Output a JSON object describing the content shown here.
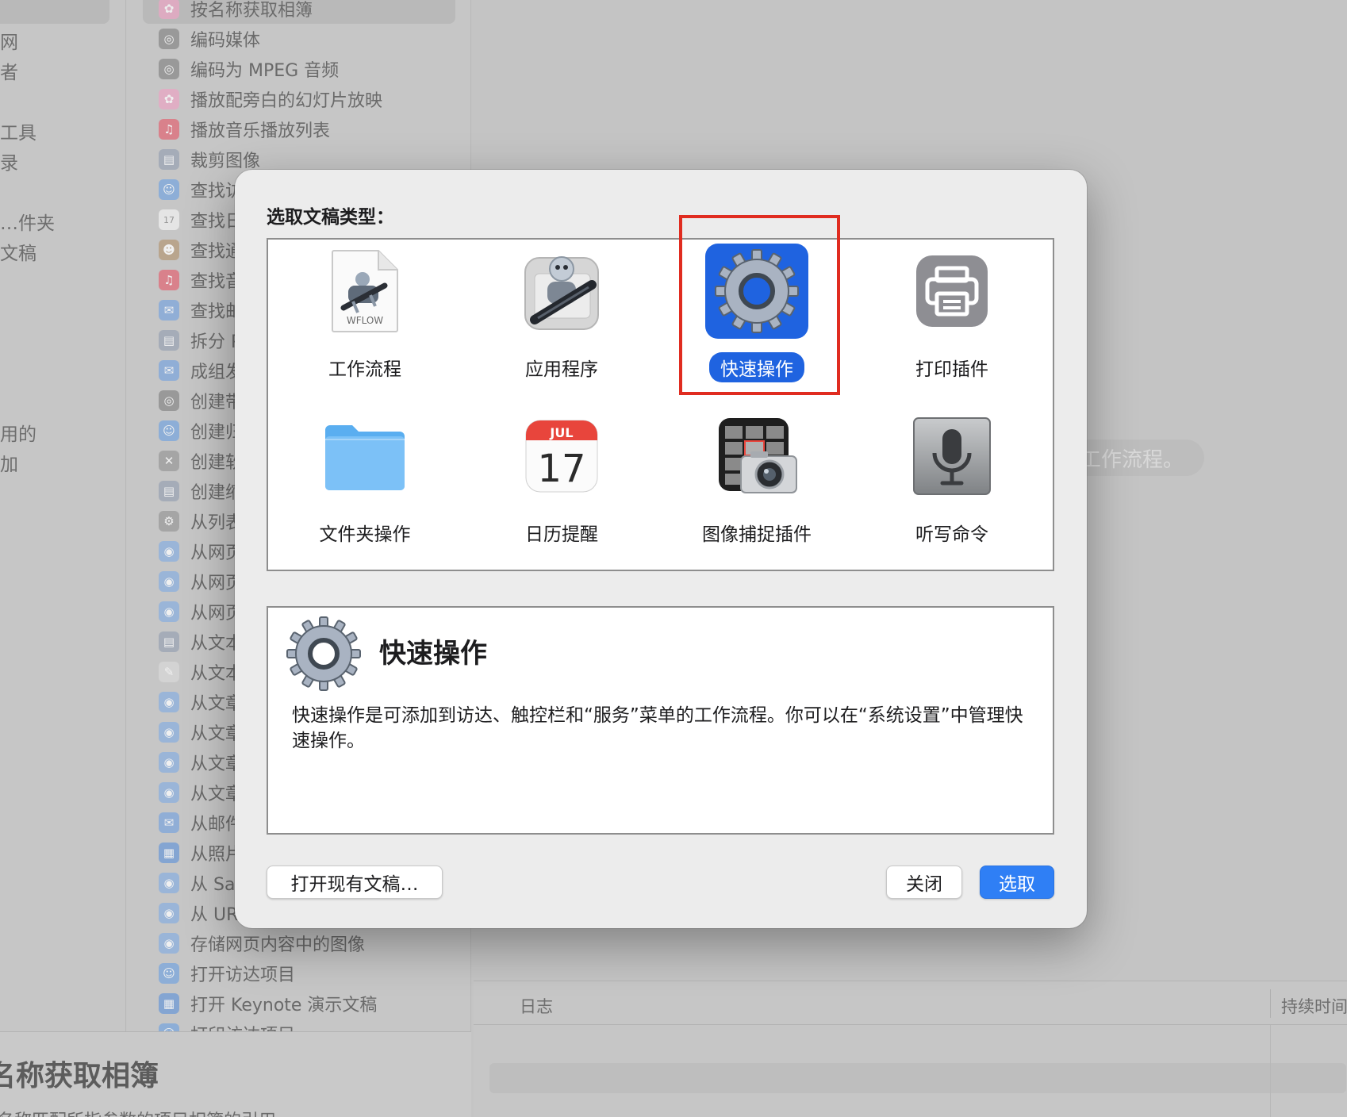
{
  "background": {
    "left_fragments": [
      "网",
      "者",
      "工具",
      "录",
      "…件夹",
      "文稿",
      "用的",
      "加"
    ],
    "action_list": [
      {
        "label": "按名称获取相簿",
        "icon": "photos-icon",
        "color": "#e9a7c4"
      },
      {
        "label": "编码媒体",
        "icon": "quicktime-icon",
        "color": "#8a8a8a"
      },
      {
        "label": "编码为 MPEG 音频",
        "icon": "quicktime-icon",
        "color": "#8a8a8a"
      },
      {
        "label": "播放配旁白的幻灯片放映",
        "icon": "photos-icon",
        "color": "#e9a7c4"
      },
      {
        "label": "播放音乐播放列表",
        "icon": "music-icon",
        "color": "#e06a78"
      },
      {
        "label": "裁剪图像",
        "icon": "preview-icon",
        "color": "#9aa4b4"
      },
      {
        "label": "查找访",
        "icon": "finder-icon",
        "color": "#7aa7dd"
      },
      {
        "label": "查找日",
        "icon": "calendar-icon",
        "color": "#f0f0f0"
      },
      {
        "label": "查找通",
        "icon": "contacts-icon",
        "color": "#b59a7a"
      },
      {
        "label": "查找音",
        "icon": "music-icon",
        "color": "#e06a78"
      },
      {
        "label": "查找邮",
        "icon": "mail-icon",
        "color": "#7fa6dc"
      },
      {
        "label": "拆分 P",
        "icon": "preview-icon",
        "color": "#9aa4b4"
      },
      {
        "label": "成组发",
        "icon": "mail-icon",
        "color": "#7fa6dc"
      },
      {
        "label": "创建带",
        "icon": "quicktime-icon",
        "color": "#8a8a8a"
      },
      {
        "label": "创建归",
        "icon": "finder-icon",
        "color": "#7aa7dd"
      },
      {
        "label": "创建软",
        "icon": "tools-icon",
        "color": "#9a9a9a"
      },
      {
        "label": "创建缩",
        "icon": "preview-icon",
        "color": "#9aa4b4"
      },
      {
        "label": "从列表",
        "icon": "automator-icon",
        "color": "#9a9a9a"
      },
      {
        "label": "从网页",
        "icon": "safari-icon",
        "color": "#8cb0de"
      },
      {
        "label": "从网页",
        "icon": "safari-icon",
        "color": "#8cb0de"
      },
      {
        "label": "从网页",
        "icon": "safari-icon",
        "color": "#8cb0de"
      },
      {
        "label": "从文本",
        "icon": "preview-icon",
        "color": "#9aa4b4"
      },
      {
        "label": "从文本",
        "icon": "textedit-icon",
        "color": "#d8d8d8"
      },
      {
        "label": "从文章",
        "icon": "safari-icon",
        "color": "#8cb0de"
      },
      {
        "label": "从文章",
        "icon": "safari-icon",
        "color": "#8cb0de"
      },
      {
        "label": "从文章",
        "icon": "safari-icon",
        "color": "#8cb0de"
      },
      {
        "label": "从文章",
        "icon": "safari-icon",
        "color": "#8cb0de"
      },
      {
        "label": "从邮件",
        "icon": "mail-icon",
        "color": "#7fa6dc"
      },
      {
        "label": "从照片",
        "icon": "keynote-icon",
        "color": "#6f9ad6"
      },
      {
        "label": "从 Saf",
        "icon": "safari-icon",
        "color": "#8cb0de"
      },
      {
        "label": "从 UR",
        "icon": "safari-icon",
        "color": "#8cb0de"
      },
      {
        "label": "存储网页内容中的图像",
        "icon": "safari-icon",
        "color": "#8cb0de"
      },
      {
        "label": "打开访达项目",
        "icon": "finder-icon",
        "color": "#7aa7dd"
      },
      {
        "label": "打开 Keynote 演示文稿",
        "icon": "keynote-icon",
        "color": "#6f9ad6"
      },
      {
        "label": "打印访达项目",
        "icon": "finder-icon",
        "color": "#7aa7dd"
      }
    ],
    "bottom_title": "名称获取相簿",
    "bottom_desc": "名称匹配所指参数的项目相簿的引用",
    "canvas_hint": "工作流程。",
    "log_col_log": "日志",
    "log_col_duration": "持续时间"
  },
  "dialog": {
    "title": "选取文稿类型：",
    "types": [
      {
        "label": "工作流程",
        "icon": "workflow-document-icon",
        "badge": "WFLOW"
      },
      {
        "label": "应用程序",
        "icon": "automator-robot-icon"
      },
      {
        "label": "快速操作",
        "icon": "gear-icon",
        "selected": true
      },
      {
        "label": "打印插件",
        "icon": "printer-icon"
      },
      {
        "label": "文件夹操作",
        "icon": "folder-icon"
      },
      {
        "label": "日历提醒",
        "icon": "calendar-icon",
        "month": "JUL",
        "day": "17"
      },
      {
        "label": "图像捕捉插件",
        "icon": "image-capture-icon"
      },
      {
        "label": "听写命令",
        "icon": "microphone-icon"
      }
    ],
    "description": {
      "title": "快速操作",
      "text": "快速操作是可添加到访达、触控栏和“服务”菜单的工作流程。你可以在“系统设置”中管理快速操作。"
    },
    "buttons": {
      "open_existing": "打开现有文稿…",
      "close": "关闭",
      "choose": "选取"
    }
  },
  "colors": {
    "accent": "#2f7ff5",
    "selection": "#1f63e0",
    "highlight_box": "#e02c20"
  }
}
